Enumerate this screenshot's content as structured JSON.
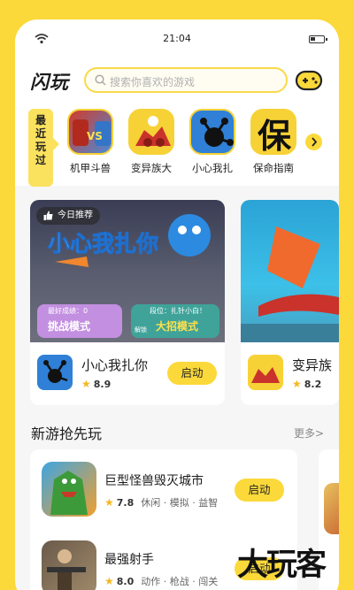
{
  "status": {
    "time": "21:04"
  },
  "header": {
    "logo": "闪玩",
    "search_placeholder": "搜索你喜欢的游戏"
  },
  "recent": {
    "label": "最近玩过",
    "games": [
      {
        "name": "机甲斗兽",
        "icon": "mecha-beast-icon"
      },
      {
        "name": "变异族大",
        "icon": "mutant-icon"
      },
      {
        "name": "小心我扎",
        "icon": "stickman-icon"
      },
      {
        "name": "保命指南",
        "icon": "survival-guide-icon"
      }
    ]
  },
  "featured": [
    {
      "tag": "今日推荐",
      "banner_title": "小心我扎你",
      "banner_best": "最好成绩：0",
      "banner_challenge": "挑战模式",
      "banner_rank": "段位：扎针小白！",
      "banner_unlock": "解锁",
      "banner_mode": "大招模式",
      "name": "小心我扎你",
      "rating": "8.9",
      "launch": "启动"
    },
    {
      "name": "变异族",
      "rating": "8.2"
    }
  ],
  "section": {
    "title": "新游抢先玩",
    "more": "更多>"
  },
  "list": [
    {
      "name": "巨型怪兽毁灭城市",
      "rating": "7.8",
      "tags": "休闲 · 模拟 · 益智",
      "launch": "启动"
    },
    {
      "name": "最强射手",
      "rating": "8.0",
      "tags": "动作 · 枪战 · 闯关",
      "launch": "启动"
    }
  ],
  "watermark": "大玩客",
  "colors": {
    "accent": "#fbd93a",
    "star": "#f5b821"
  }
}
